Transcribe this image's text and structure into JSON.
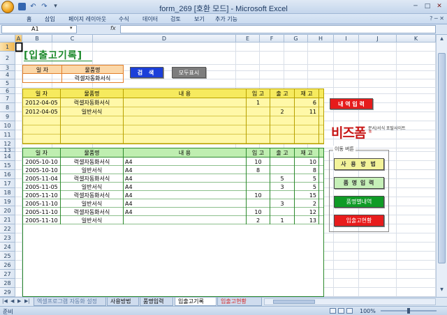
{
  "window": {
    "title": "form_269  [호환 모드] - Microsoft Excel",
    "controls": {
      "minimize": "─",
      "maximize": "□",
      "close": "✕"
    }
  },
  "qat": {
    "undo": "↶",
    "redo": "↷",
    "more": "▾"
  },
  "ribbon": {
    "tabs": [
      "홈",
      "삽입",
      "페이지 레이아웃",
      "수식",
      "데이터",
      "검토",
      "보기",
      "추가 기능"
    ],
    "right": "? ─ ✕"
  },
  "formula_bar": {
    "name_box": "A1",
    "fx": "fx",
    "value": ""
  },
  "columns": [
    "A",
    "B",
    "C",
    "D",
    "E",
    "F",
    "G",
    "H",
    "I",
    "J",
    "K"
  ],
  "rows": [
    "1",
    "2",
    "3",
    "4",
    "5",
    "6",
    "7",
    "8",
    "9",
    "10",
    "11",
    "12",
    "13",
    "14",
    "15",
    "16",
    "17",
    "18",
    "19",
    "20",
    "21",
    "22",
    "23",
    "24",
    "25",
    "26",
    "27",
    "28",
    "29"
  ],
  "sheet": {
    "heading": "[입출고기록]",
    "search": {
      "headers": [
        "일 자",
        "물품명"
      ],
      "values": [
        "",
        "럭셀자동화서식"
      ]
    },
    "search_button": "검 색",
    "show_all_button": "모두표시",
    "input_table": {
      "headers": [
        "일 자",
        "물품명",
        "내 용",
        "입 고",
        "출 고",
        "재 고"
      ],
      "rows": [
        [
          "2012-04-05",
          "럭셀자동화서식",
          "",
          "1",
          "",
          "6"
        ],
        [
          "2012-04-05",
          "일반서식",
          "",
          "",
          "2",
          "11"
        ],
        [
          "",
          "",
          "",
          "",
          "",
          ""
        ],
        [
          "",
          "",
          "",
          "",
          "",
          ""
        ],
        [
          "",
          "",
          "",
          "",
          "",
          ""
        ]
      ]
    },
    "entry_button": "내 역 입 력",
    "logo": {
      "main": "비즈폼",
      "sub": "문서/서식 포탈사이트",
      "reg": "®"
    },
    "list_table": {
      "headers": [
        "일 자",
        "물품명",
        "내 용",
        "입 고",
        "출 고",
        "재 고"
      ],
      "rows": [
        [
          "2005-10-10",
          "럭셀자동화서식",
          "A4",
          "10",
          "",
          "10"
        ],
        [
          "2005-10-10",
          "일반서식",
          "A4",
          "8",
          "",
          "8"
        ],
        [
          "2005-11-04",
          "럭셀자동화서식",
          "A4",
          "",
          "5",
          "5"
        ],
        [
          "2005-11-05",
          "일반서식",
          "A4",
          "",
          "3",
          "5"
        ],
        [
          "2005-11-10",
          "럭셀자동화서식",
          "A4",
          "10",
          "",
          "15"
        ],
        [
          "2005-11-10",
          "일반서식",
          "A4",
          "",
          "3",
          "2"
        ],
        [
          "2005-11-10",
          "럭셀자동화서식",
          "A4",
          "10",
          "",
          "12"
        ],
        [
          "2005-11-10",
          "일반서식",
          "",
          "2",
          "1",
          "13"
        ]
      ]
    },
    "nav": {
      "group_label": "이동 버튼",
      "howto": "사 용 방 법",
      "product_entry": "품 명 입 력",
      "by_product": "품명별내역",
      "inout_status": "입출고현황"
    }
  },
  "sheet_tabs": {
    "nav": [
      "|◀",
      "◀",
      "▶",
      "▶|"
    ],
    "tabs": [
      "엑셀프로그램 자동화 설정",
      "사용방법",
      "품명입력",
      "입출고기록",
      "입출고현황"
    ],
    "active": 3
  },
  "status_bar": {
    "status": "준비",
    "zoom": "100%"
  }
}
